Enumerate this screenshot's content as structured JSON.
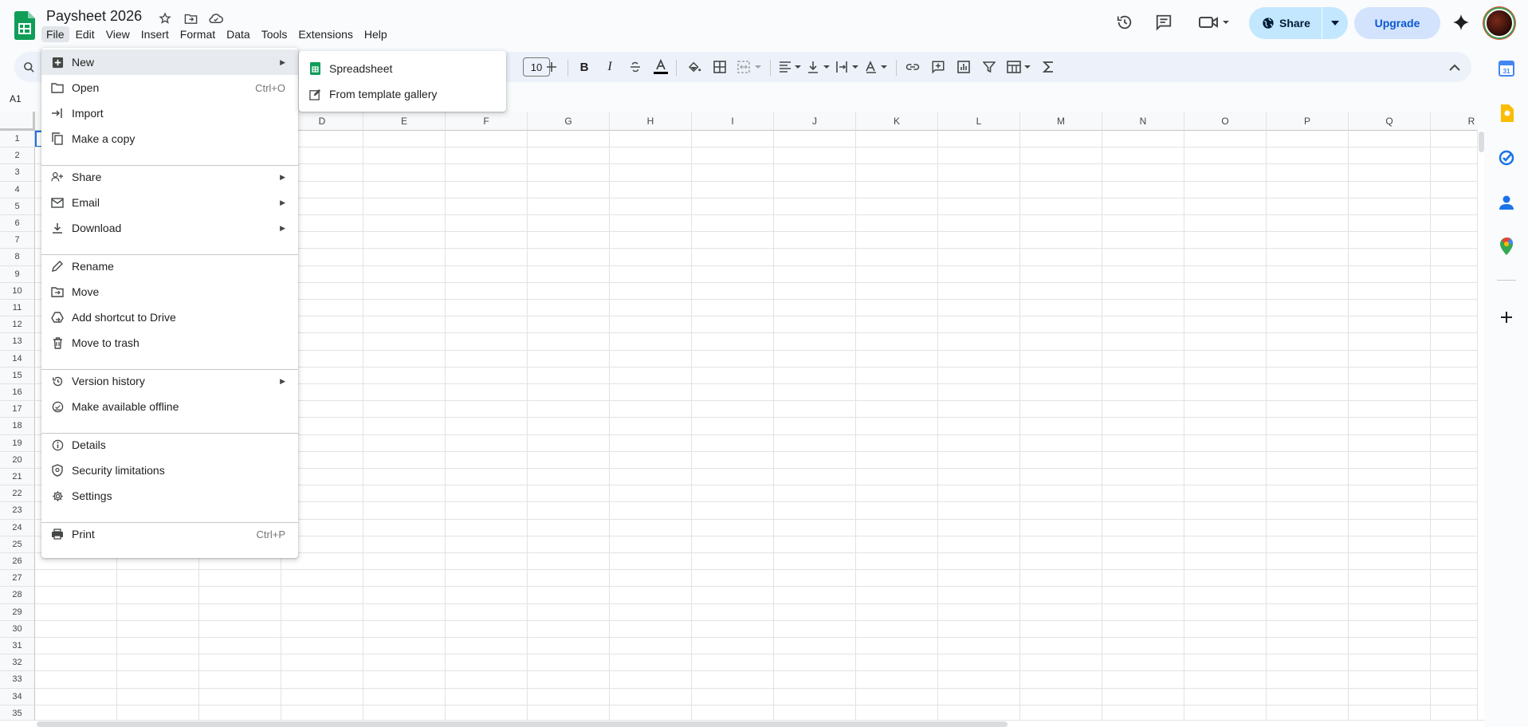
{
  "document": {
    "title": "Paysheet 2026"
  },
  "menubar": [
    "File",
    "Edit",
    "View",
    "Insert",
    "Format",
    "Data",
    "Tools",
    "Extensions",
    "Help"
  ],
  "header": {
    "share_label": "Share",
    "upgrade_label": "Upgrade"
  },
  "toolbar": {
    "font_size": "10"
  },
  "name_box": "A1",
  "columns": [
    "D",
    "E",
    "F",
    "G",
    "H",
    "I",
    "J",
    "K",
    "L",
    "M",
    "N",
    "O",
    "P",
    "Q",
    "R"
  ],
  "rows": [
    "1",
    "2",
    "3",
    "4",
    "5",
    "6",
    "7",
    "8",
    "9",
    "10",
    "11",
    "12",
    "13",
    "14",
    "15",
    "16",
    "17",
    "18",
    "19",
    "20",
    "21",
    "22",
    "23",
    "24",
    "25",
    "26",
    "27",
    "28",
    "29",
    "30",
    "31",
    "32",
    "33",
    "34",
    "35"
  ],
  "file_menu": {
    "items": [
      {
        "label": "New",
        "icon": "add-box-icon",
        "submenu": true
      },
      {
        "label": "Open",
        "icon": "folder-icon",
        "shortcut": "Ctrl+O"
      },
      {
        "label": "Import",
        "icon": "import-icon"
      },
      {
        "label": "Make a copy",
        "icon": "copy-icon"
      },
      {
        "label": "Share",
        "icon": "person-add-icon",
        "submenu": true
      },
      {
        "label": "Email",
        "icon": "mail-icon",
        "submenu": true
      },
      {
        "label": "Download",
        "icon": "download-icon",
        "submenu": true
      },
      {
        "label": "Rename",
        "icon": "pencil-icon"
      },
      {
        "label": "Move",
        "icon": "move-folder-icon"
      },
      {
        "label": "Add shortcut to Drive",
        "icon": "drive-shortcut-icon"
      },
      {
        "label": "Move to trash",
        "icon": "trash-icon"
      },
      {
        "label": "Version history",
        "icon": "history-icon",
        "submenu": true
      },
      {
        "label": "Make available offline",
        "icon": "offline-icon"
      },
      {
        "label": "Details",
        "icon": "info-icon"
      },
      {
        "label": "Security limitations",
        "icon": "shield-icon"
      },
      {
        "label": "Settings",
        "icon": "gear-icon"
      },
      {
        "label": "Print",
        "icon": "print-icon",
        "shortcut": "Ctrl+P"
      }
    ]
  },
  "new_submenu": {
    "items": [
      {
        "label": "Spreadsheet",
        "icon": "sheets-icon"
      },
      {
        "label": "From template gallery",
        "icon": "template-icon"
      }
    ]
  },
  "colors": {
    "accent": "#1a73e8",
    "share_bg": "#c2e7ff",
    "upgrade_bg": "#d3e3fd",
    "sheets_green": "#0f9d58"
  }
}
